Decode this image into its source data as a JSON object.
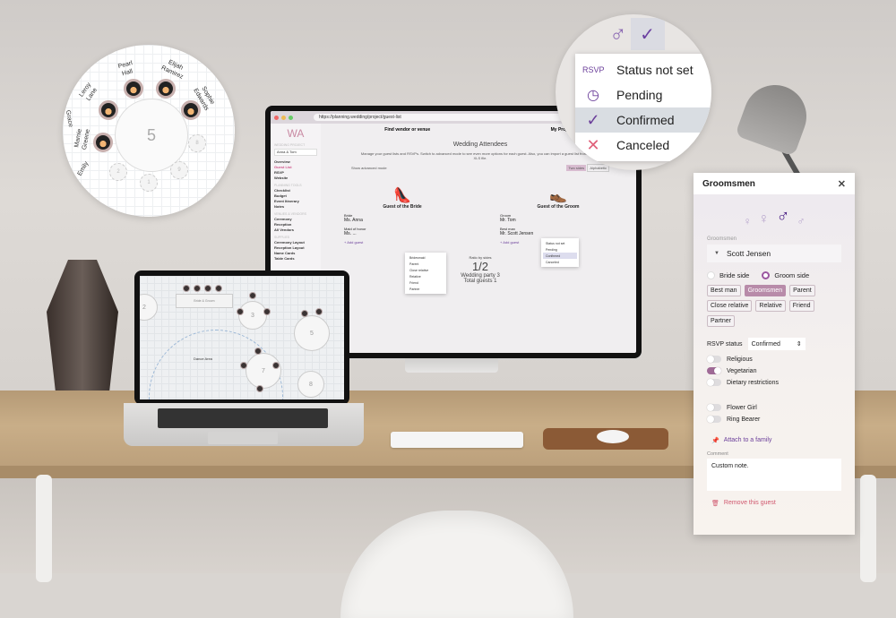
{
  "imac": {
    "url": "https://planning.wedding/project/guest-list",
    "logo": "WA",
    "project_caption": "WEDDING PROJECT",
    "project_select": "Anna & Tom",
    "nav": [
      "Find vendor or venue",
      "My Projects"
    ],
    "sidebar_items": [
      "Overview",
      "Guest List",
      "RSVP",
      "Website"
    ],
    "tools_caption": "PLANNING TOOLS",
    "tools_items": [
      "Checklist",
      "Budget",
      "Event Itinerary",
      "Notes"
    ],
    "vendors_caption": "VENUES & VENDORS",
    "vendors_items": [
      "Ceremony",
      "Reception",
      "All Vendors"
    ],
    "supplies_caption": "SUPPLIES",
    "supplies_items": [
      "Ceremony Layout",
      "Reception Layout",
      "Name Cards",
      "Table Cards"
    ],
    "page_title": "Wedding Attendees",
    "description": "Manage your guest lists and RSVPs. Switch to advanced mode to see even more options for each guest. Also, you can import a guest list from CSV or XLS file.",
    "advanced_mode": "Show advanced mode",
    "view_toggle": [
      "Two sides",
      "Alphabetic"
    ],
    "bride_col": {
      "title": "Guest of the Bride",
      "rows": [
        {
          "role": "Bride",
          "name": "Ms. Anna"
        },
        {
          "role": "Maid of honor",
          "name": "Ms. ..."
        }
      ],
      "add": "+ Add guest"
    },
    "groom_col": {
      "title": "Guest of the Groom",
      "rows": [
        {
          "role": "Groom",
          "name": "Mr. Tom"
        },
        {
          "role": "Best man",
          "name": "Mr. Scott Jensen"
        }
      ],
      "add": "+ Add guest"
    },
    "role_menu": [
      "Bridesmaid",
      "Parent",
      "Close relative",
      "Relative",
      "Friend",
      "Partner"
    ],
    "ratio_label": "Ratio by sides",
    "ratio": "1/2",
    "wedding_party": "Wedding party 3",
    "total_guests": "Total guests 1"
  },
  "laptop": {
    "head_table": "Bride & Groom",
    "dance_area": "Dance Area",
    "tables": [
      "2",
      "3",
      "5",
      "7",
      "8"
    ]
  },
  "table_callout": {
    "table_number": "5",
    "guests": [
      "Pearl Hall",
      "Elijah Ramirez",
      "Sophie Edwards",
      "Leroy Lane",
      "Mamie Greene",
      "Emily",
      "Grace"
    ],
    "empty_seats": [
      "8",
      "9",
      "1",
      "2"
    ]
  },
  "rsvp_callout": {
    "options": [
      {
        "icon": "RSVP",
        "label": "Status not set"
      },
      {
        "icon": "clock",
        "label": "Pending"
      },
      {
        "icon": "check",
        "label": "Confirmed",
        "selected": true
      },
      {
        "icon": "x",
        "label": "Canceled"
      }
    ]
  },
  "panel": {
    "title": "Groomsmen",
    "field_label": "Groomsmen",
    "guest_name": "Scott Jensen",
    "sides": [
      {
        "label": "Bride side",
        "checked": false
      },
      {
        "label": "Groom side",
        "checked": true
      }
    ],
    "roles": [
      {
        "label": "Best man",
        "active": false
      },
      {
        "label": "Groomsmen",
        "active": true
      },
      {
        "label": "Parent",
        "active": false
      },
      {
        "label": "Close relative",
        "active": false
      },
      {
        "label": "Relative",
        "active": false
      },
      {
        "label": "Friend",
        "active": false
      },
      {
        "label": "Partner",
        "active": false
      }
    ],
    "rsvp_label": "RSVP status",
    "rsvp_value": "Confirmed",
    "toggles": [
      {
        "label": "Religious",
        "on": false
      },
      {
        "label": "Vegetarian",
        "on": true
      },
      {
        "label": "Dietary restrictions",
        "on": false
      },
      {
        "label": "Flower Girl",
        "on": false
      },
      {
        "label": "Ring Bearer",
        "on": false
      }
    ],
    "attach": "Attach to a family",
    "comment_label": "Comment",
    "comment": "Custom note.",
    "remove": "Remove this guest",
    "accent": "#6b3f9a",
    "danger": "#d0576e"
  }
}
